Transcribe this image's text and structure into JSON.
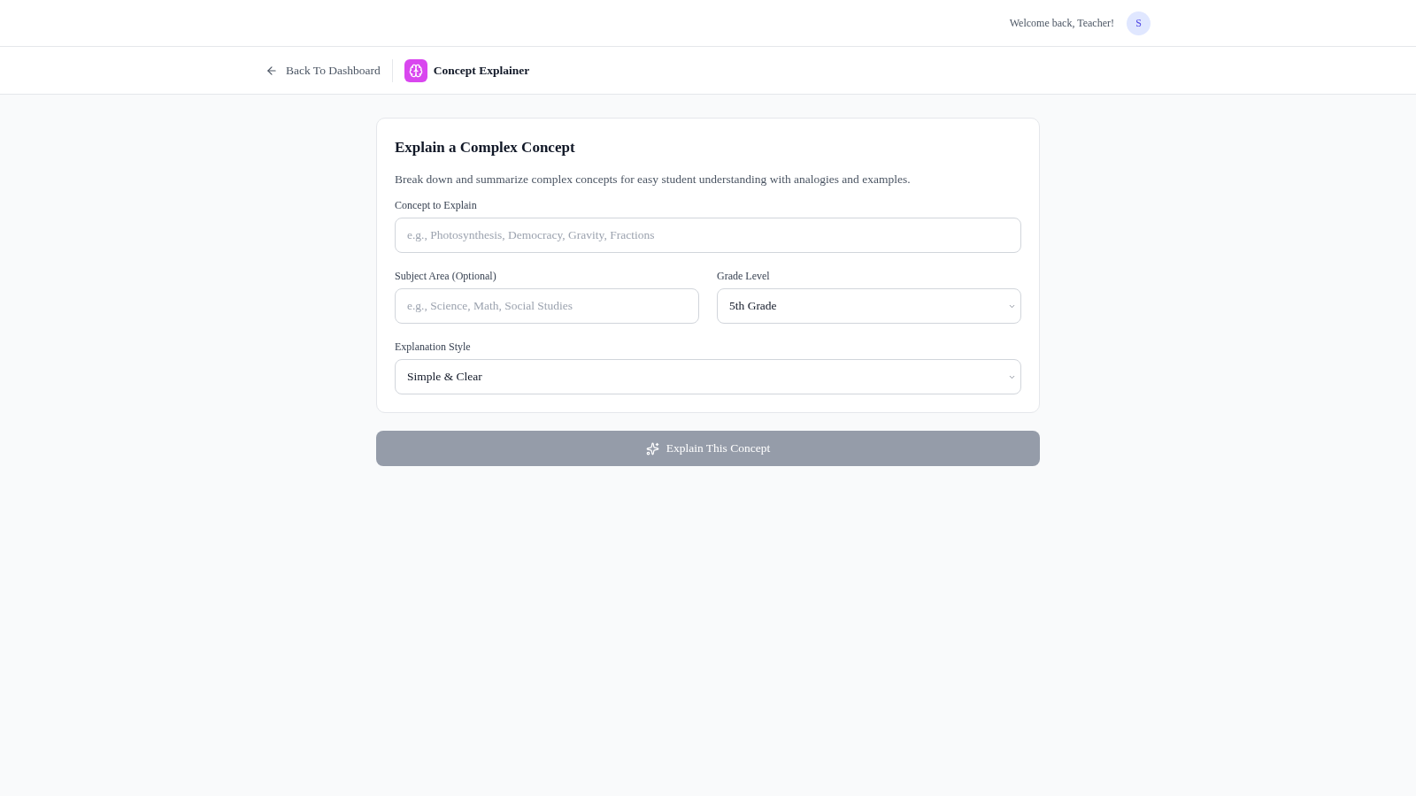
{
  "header": {
    "greeting": "Welcome back, Teacher!",
    "avatar_initial": "S"
  },
  "toolbar": {
    "back_link": "Back To Dashboard",
    "tool_title": "Concept Explainer"
  },
  "form": {
    "title": "Explain a Complex Concept",
    "description": "Break down and summarize complex concepts for easy student understanding with analogies and examples.",
    "rows": [
      [
        {
          "kind": "text",
          "label": "Concept to Explain",
          "placeholder": "e.g., Photosynthesis, Democracy, Gravity, Fractions"
        }
      ],
      [
        {
          "kind": "text",
          "label": "Subject Area (Optional)",
          "placeholder": "e.g., Science, Math, Social Studies"
        },
        {
          "kind": "select",
          "label": "Grade Level",
          "value": "5th Grade"
        }
      ],
      [
        {
          "kind": "select",
          "label": "Explanation Style",
          "value": "Simple & Clear"
        }
      ]
    ],
    "submit": {
      "label": "Explain This Concept",
      "disabled": true
    }
  }
}
